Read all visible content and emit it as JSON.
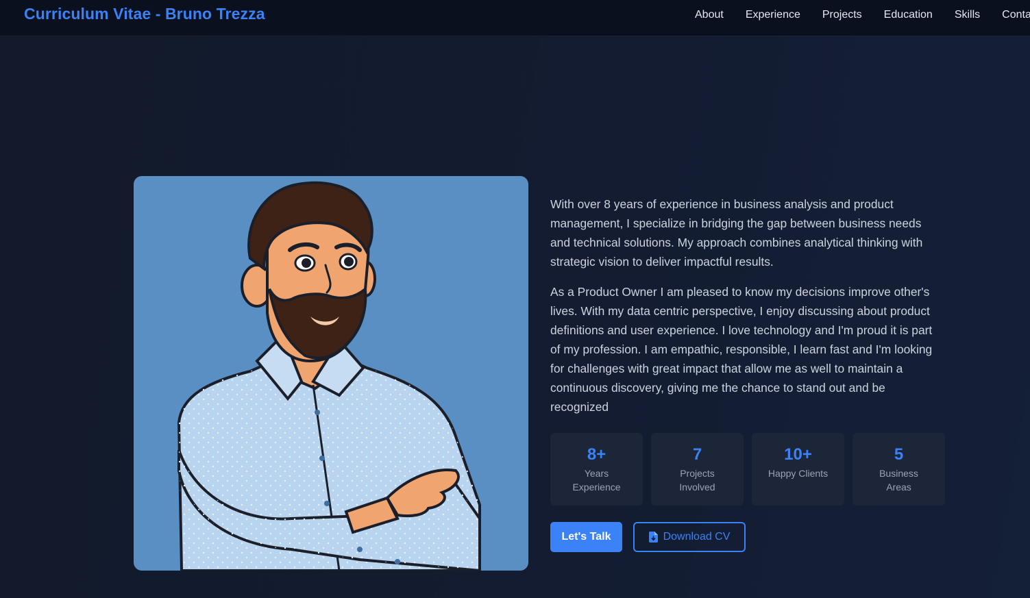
{
  "header": {
    "brand": "Curriculum Vitae - Bruno Trezza",
    "nav": [
      "About",
      "Experience",
      "Projects",
      "Education",
      "Skills",
      "Contact"
    ]
  },
  "about": {
    "paragraphs": [
      "With over 8 years of experience in business analysis and product management, I specialize in bridging the gap between business needs and technical solutions. My approach combines analytical thinking with strategic vision to deliver impactful results.",
      "As a Product Owner I am pleased to know my decisions improve other's lives. With my data centric perspective, I enjoy discussing about product definitions and user experience. I love technology and I'm proud it is part of my profession. I am empathic, responsible, I learn fast and I'm looking for challenges with great impact that allow me as well to maintain a continuous discovery, giving me the chance to stand out and be recognized"
    ]
  },
  "stats": [
    {
      "value": "8+",
      "label": "Years Experience"
    },
    {
      "value": "7",
      "label": "Projects Involved"
    },
    {
      "value": "10+",
      "label": "Happy Clients"
    },
    {
      "value": "5",
      "label": "Business Areas"
    }
  ],
  "actions": {
    "talk_label": "Let's Talk",
    "download_label": "Download CV",
    "download_icon": "file-download-icon"
  },
  "colors": {
    "accent": "#3b82f6",
    "background": "#121a2b",
    "card": "#1c2638",
    "portrait_bg": "#5a8fc4"
  }
}
